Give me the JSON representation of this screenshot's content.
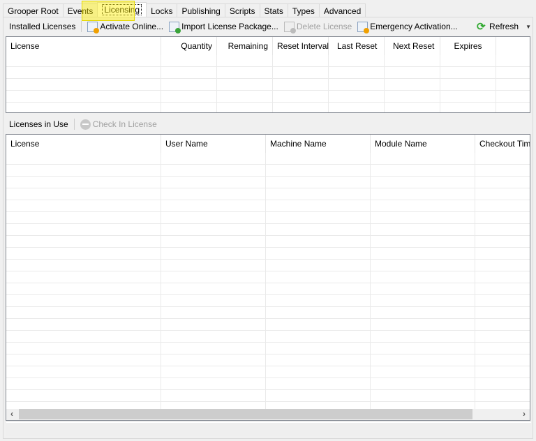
{
  "tabs": [
    "Grooper Root",
    "Events",
    "Licensing",
    "Locks",
    "Publishing",
    "Scripts",
    "Stats",
    "Types",
    "Advanced"
  ],
  "selected_tab": "Licensing",
  "installed": {
    "label": "Installed Licenses",
    "buttons": {
      "activate": "Activate Online...",
      "import": "Import License Package...",
      "delete": "Delete License",
      "emergency": "Emergency Activation...",
      "refresh": "Refresh"
    },
    "columns": [
      "License",
      "Quantity",
      "Remaining",
      "Reset Interval",
      "Last Reset",
      "Next Reset",
      "Expires",
      ""
    ]
  },
  "in_use": {
    "label": "Licenses in Use",
    "buttons": {
      "check_in": "Check In License"
    },
    "columns": [
      "License",
      "User Name",
      "Machine Name",
      "Module Name",
      "Checkout Time"
    ]
  }
}
